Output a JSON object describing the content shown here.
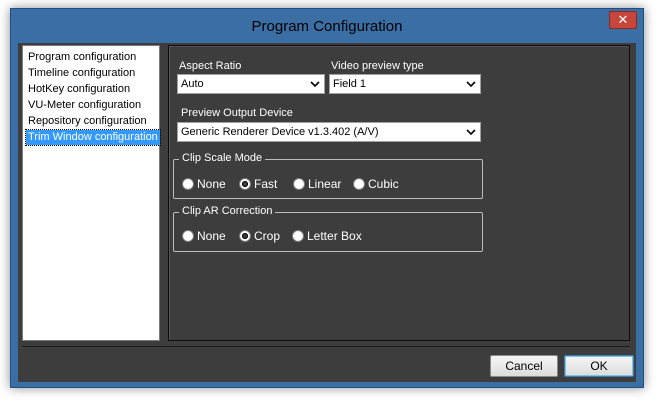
{
  "window": {
    "title": "Program Configuration",
    "close_label": "✕"
  },
  "sidebar": {
    "items": [
      {
        "label": "Program configuration",
        "selected": false
      },
      {
        "label": "Timeline configuration",
        "selected": false
      },
      {
        "label": "HotKey configuration",
        "selected": false
      },
      {
        "label": "VU-Meter configuration",
        "selected": false
      },
      {
        "label": "Repository configuration",
        "selected": false
      },
      {
        "label": "Trim Window configuration",
        "selected": true
      }
    ]
  },
  "settings": {
    "aspect_ratio": {
      "label": "Aspect Ratio",
      "value": "Auto"
    },
    "video_preview_type": {
      "label": "Video preview type",
      "value": "Field 1"
    },
    "preview_output_device": {
      "label": "Preview Output Device",
      "value": "Generic Renderer Device v1.3.402 (A/V)"
    },
    "clip_scale_mode": {
      "title": "Clip Scale Mode",
      "options": [
        {
          "label": "None",
          "checked": false
        },
        {
          "label": "Fast",
          "checked": true
        },
        {
          "label": "Linear",
          "checked": false
        },
        {
          "label": "Cubic",
          "checked": false
        }
      ]
    },
    "clip_ar_correction": {
      "title": "Clip AR Correction",
      "options": [
        {
          "label": "None",
          "checked": false
        },
        {
          "label": "Crop",
          "checked": true
        },
        {
          "label": "Letter Box",
          "checked": false
        }
      ]
    }
  },
  "footer": {
    "cancel_label": "Cancel",
    "ok_label": "OK"
  }
}
